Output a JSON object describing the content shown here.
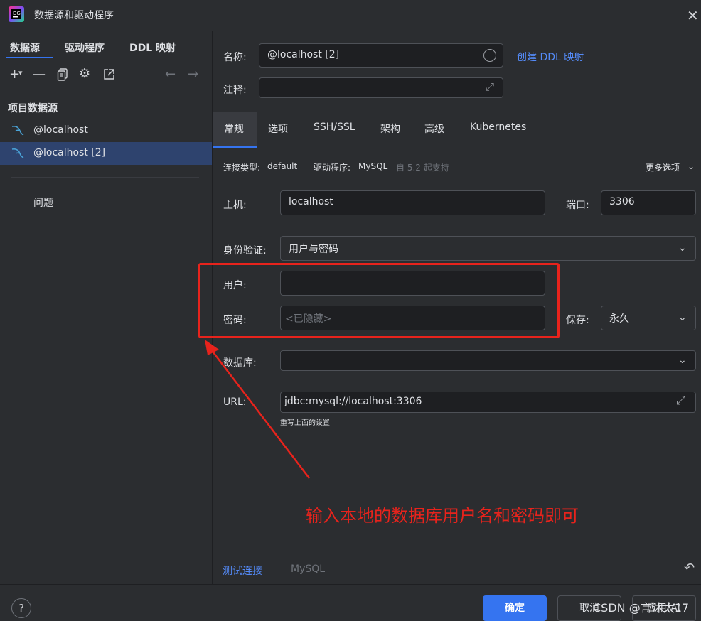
{
  "window": {
    "title": "数据源和驱动程序",
    "close_icon": "close-icon"
  },
  "left": {
    "tabs": [
      {
        "label": "数据源"
      },
      {
        "label": "驱动程序"
      },
      {
        "label": "DDL 映射"
      }
    ],
    "toolbar_icons": [
      "add-icon",
      "remove-icon",
      "copy-icon",
      "settings-icon",
      "export-icon",
      "back-arrow-icon",
      "forward-arrow-icon"
    ],
    "section_title": "项目数据源",
    "items": [
      {
        "label": "@localhost"
      },
      {
        "label": "@localhost [2]"
      }
    ],
    "issues_label": "问题"
  },
  "right": {
    "name_label": "名称:",
    "name_value": "@localhost [2]",
    "create_ddl_link": "创建 DDL 映射",
    "comment_label": "注释:",
    "tabs": [
      {
        "label": "常规"
      },
      {
        "label": "选项"
      },
      {
        "label": "SSH/SSL"
      },
      {
        "label": "架构"
      },
      {
        "label": "高级"
      },
      {
        "label": "Kubernetes"
      }
    ],
    "conn_type_label": "连接类型:",
    "conn_type_value": "default",
    "driver_label": "驱动程序:",
    "driver_value": "MySQL",
    "driver_note": "自 5.2 起支持",
    "more_options": "更多选项",
    "host_label": "主机:",
    "host_value": "localhost",
    "port_label": "端口:",
    "port_value": "3306",
    "auth_label": "身份验证:",
    "auth_value": "用户与密码",
    "user_label": "用户:",
    "user_value": "",
    "password_label": "密码:",
    "password_placeholder": "<已隐藏>",
    "save_label": "保存:",
    "save_value": "永久",
    "database_label": "数据库:",
    "database_value": "",
    "url_label": "URL:",
    "url_value": "jdbc:mysql://localhost:3306",
    "url_hint": "重写上面的设置",
    "test_connection": "测试连接",
    "driver_footer": "MySQL"
  },
  "footer": {
    "help": "?",
    "ok": "确定",
    "cancel": "取消",
    "apply": "应用(A)"
  },
  "annotation": {
    "text": "输入本地的数据库用户名和密码即可",
    "color": "#e8231c"
  },
  "watermark": "CSDN @言沐太17",
  "colors": {
    "accent": "#3574f0",
    "link": "#548af7",
    "selection": "#2e436e",
    "bg": "#2b2d30"
  }
}
